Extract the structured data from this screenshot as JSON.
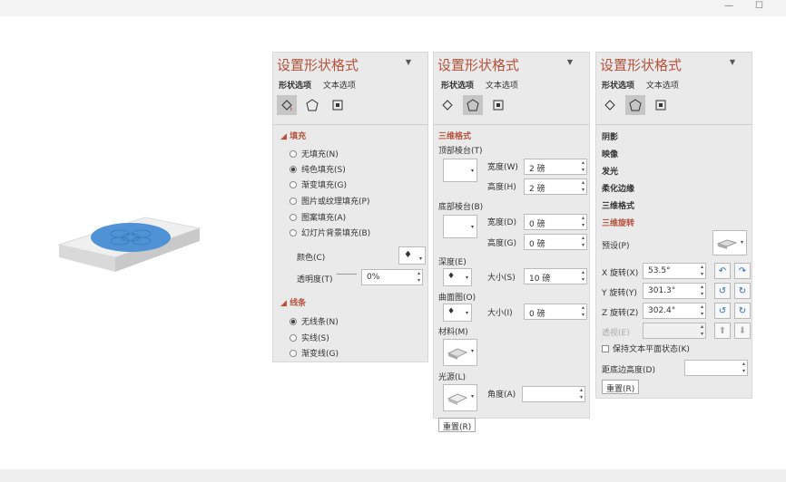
{
  "window": {
    "minimize_glyph": "—",
    "maximize_glyph": "☐"
  },
  "panes": [
    {
      "title": "设置形状格式",
      "tabs": [
        "形状选项",
        "文本选项"
      ],
      "fill_section": "填充",
      "fill_options": [
        "无填充(N)",
        "纯色填充(S)",
        "渐变填充(G)",
        "图片或纹理填充(P)",
        "图案填充(A)",
        "幻灯片背景填充(B)"
      ],
      "fill_selected": 1,
      "color_label": "颜色(C)",
      "transparency_label": "透明度(T)",
      "transparency_value": "0%",
      "line_section": "线条",
      "line_options": [
        "无线条(N)",
        "实线(S)",
        "渐变线(G)"
      ],
      "line_selected": 0
    },
    {
      "title": "设置形状格式",
      "tabs": [
        "形状",
        "选项",
        "文本选项"
      ],
      "section": "三维格式",
      "top_bevel": "顶部棱台(T)",
      "bottom_bevel": "底部棱台(B)",
      "width_label_top": "宽度(W)",
      "width_value_top": "2 磅",
      "height_label_top": "高度(H)",
      "height_value_top": "2 磅",
      "width_label_bottom": "宽度(D)",
      "width_value_bottom": "0 磅",
      "height_label_bottom": "高度(G)",
      "height_value_bottom": "0 磅",
      "depth": "深度(E)",
      "depth_size_label": "大小(S)",
      "depth_size_value": "10 磅",
      "contour": "曲面图(O)",
      "contour_size_label": "大小(I)",
      "contour_size_value": "0 磅",
      "material": "材料(M)",
      "lighting": "光源(L)",
      "angle_label": "角度(A)",
      "angle_value": "",
      "reset": "重置(R)"
    },
    {
      "title": "设置形状格式",
      "tabs": [
        "形状选项",
        "文本选项"
      ],
      "categories": [
        "阴影",
        "映像",
        "发光",
        "柔化边缘",
        "三维格式"
      ],
      "active_section": "三维旋转",
      "preset_label": "预设(P)",
      "x_label": "X 旋转(X)",
      "x_value": "53.5°",
      "y_label": "Y 旋转(Y)",
      "y_value": "301.3°",
      "z_label": "Z 旋转(Z)",
      "z_value": "302.4°",
      "perspective_label": "透视(E)",
      "keep_text_flat": "保持文本平面状态(K)",
      "distance_label": "距底边高度(D)",
      "distance_value": "",
      "reset": "重置(R)"
    }
  ],
  "colors": {
    "accent": "#b4523c",
    "shape_fill": "#4f93d6",
    "pane_bg": "#eaeaea"
  }
}
